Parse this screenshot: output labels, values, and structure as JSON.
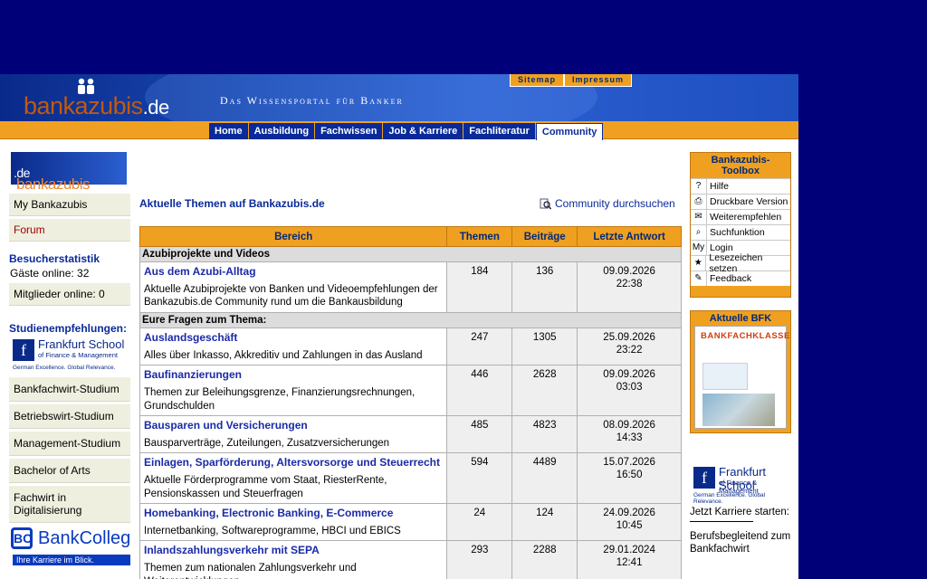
{
  "header": {
    "logo": {
      "word": "bankazubis",
      "tld": ".de"
    },
    "slogan": "Das Wissensportal für Banker",
    "toplinks": [
      "Sitemap",
      "Impressum"
    ],
    "nav": [
      {
        "label": "Home",
        "active": false
      },
      {
        "label": "Ausbildung",
        "active": false
      },
      {
        "label": "Fachwissen",
        "active": false
      },
      {
        "label": "Job & Karriere",
        "active": false
      },
      {
        "label": "Fachliteratur",
        "active": false
      },
      {
        "label": "Community",
        "active": true
      }
    ]
  },
  "left": {
    "logo": {
      "word": "bankazubis",
      "tld": ".de"
    },
    "menu": [
      {
        "label": "My Bankazubis"
      },
      {
        "label": "Forum"
      }
    ],
    "stats": {
      "title": "Besucherstatistik",
      "guests": "Gäste online: 32",
      "members": "Mitglieder online: 0"
    },
    "studies": {
      "title": "Studienempfehlungen:",
      "fs": {
        "mark": "f",
        "name": "Frankfurt School",
        "sub": "of Finance & Management",
        "claim": "German Excellence. Global Relevance."
      },
      "items": [
        "Bankfachwirt-Studium",
        "Betriebswirt-Studium",
        "Management-Studium",
        "Bachelor of Arts",
        "Fachwirt in Digitalisierung"
      ],
      "bc": {
        "mark": "BC",
        "name": "BankColleg",
        "claim": "Ihre Karriere im Blick."
      }
    }
  },
  "main": {
    "title": "Aktuelle Themen auf Bankazubis.de",
    "search": "Community durchsuchen",
    "columns": [
      "Bereich",
      "Themen",
      "Beiträge",
      "Letzte Antwort"
    ],
    "sections": [
      {
        "title": "Azubiprojekte und Videos",
        "forums": [
          {
            "name": "Aus dem Azubi-Alltag",
            "desc": "Aktuelle Azubiprojekte von Banken und Videoempfehlungen der Bankazubis.de Community rund um die Bankausbildung",
            "themen": "184",
            "beitraege": "136",
            "date": "09.09.2026",
            "time": "22:38"
          }
        ]
      },
      {
        "title": "Eure Fragen zum Thema:",
        "forums": [
          {
            "name": "Auslandsgeschäft",
            "desc": "Alles über Inkasso, Akkreditiv und Zahlungen in das Ausland",
            "themen": "247",
            "beitraege": "1305",
            "date": "25.09.2026",
            "time": "23:22"
          },
          {
            "name": "Baufinanzierungen",
            "desc": "Themen zur Beleihungsgrenze, Finanzierungsrechnungen, Grundschulden",
            "themen": "446",
            "beitraege": "2628",
            "date": "09.09.2026",
            "time": "03:03"
          },
          {
            "name": "Bausparen und Versicherungen",
            "desc": "Bausparverträge, Zuteilungen, Zusatzversicherungen",
            "themen": "485",
            "beitraege": "4823",
            "date": "08.09.2026",
            "time": "14:33"
          },
          {
            "name": "Einlagen, Sparförderung, Altersvorsorge und Steuerrecht",
            "desc": "Aktuelle Förderprogramme vom Staat, RiesterRente, Pensionskassen und Steuerfragen",
            "themen": "594",
            "beitraege": "4489",
            "date": "15.07.2026",
            "time": "16:50"
          },
          {
            "name": "Homebanking, Electronic Banking, E-Commerce",
            "desc": "Internetbanking, Softwareprogramme, HBCI und EBICS",
            "themen": "24",
            "beitraege": "124",
            "date": "24.09.2026",
            "time": "10:45"
          },
          {
            "name": "Inlandszahlungsverkehr mit SEPA",
            "desc": "Themen zum nationalen Zahlungsverkehr und Weiterentwicklungen",
            "themen": "293",
            "beitraege": "2288",
            "date": "29.01.2024",
            "time": "12:41"
          }
        ]
      }
    ]
  },
  "right": {
    "toolbox": {
      "title": "Bankazubis-Toolbox",
      "items": [
        {
          "icon": "?",
          "label": "Hilfe"
        },
        {
          "icon": "⎙",
          "label": "Druckbare Version"
        },
        {
          "icon": "✉",
          "label": "Weiterempfehlen"
        },
        {
          "icon": "⌕",
          "label": "Suchfunktion"
        },
        {
          "icon": "My",
          "label": "Login"
        },
        {
          "icon": "★",
          "label": "Lesezeichen setzen"
        },
        {
          "icon": "✎",
          "label": "Feedback"
        }
      ]
    },
    "bfk": {
      "title": "Aktuelle BFK",
      "cover": "BANKFACHKLASSE"
    },
    "ad": {
      "fs": {
        "mark": "f",
        "name": "Frankfurt School",
        "sub": "of Finance & Management",
        "claim": "German Excellence. Global Relevance."
      },
      "text1": "Jetzt Karriere starten:",
      "text2": "Berufsbegleitend zum Bankfachwirt"
    }
  }
}
